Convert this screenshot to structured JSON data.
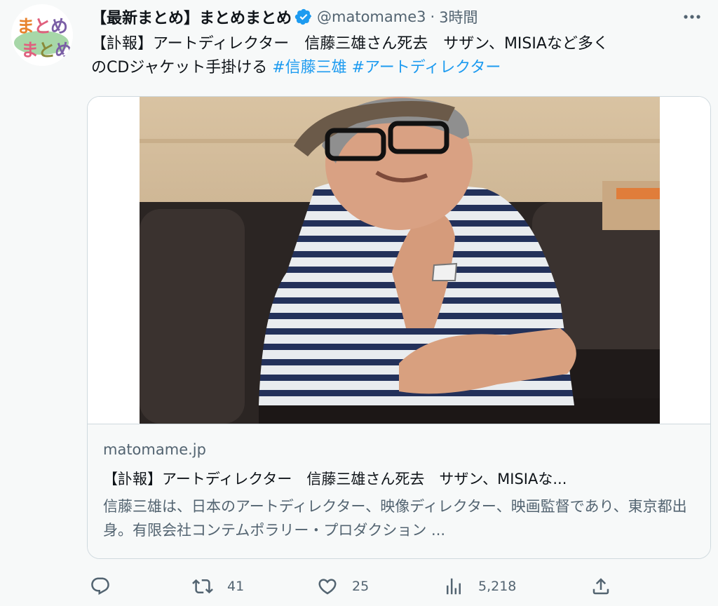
{
  "author": {
    "display_name": "【最新まとめ】まとめまとめ",
    "handle": "@matomame3",
    "separator": "·",
    "time": "3時間",
    "verified": true,
    "avatar_text": [
      "まとめ",
      "まとめ"
    ]
  },
  "tweet": {
    "line1": "【訃報】アートディレクター　信藤三雄さん死去　サザン、MISIAなど多く",
    "line2": "のCDジャケット手掛ける ",
    "hashtags": [
      "#信藤三雄",
      "#アートディレクター"
    ]
  },
  "card": {
    "domain": "matomame.jp",
    "title": "【訃報】アートディレクター　信藤三雄さん死去　サザン、MISIAな...",
    "description": "信藤三雄は、日本のアートディレクター、映像ディレクター、映画監督であり、東京都出身。有限会社コンテムポラリー・プロダクション ..."
  },
  "actions": {
    "reply_count": "",
    "retweet_count": "41",
    "like_count": "25",
    "view_count": "5,218"
  },
  "icons": {
    "verified": "verified-badge-icon",
    "more": "more-dots-icon",
    "reply": "reply-icon",
    "retweet": "retweet-icon",
    "like": "heart-icon",
    "views": "analytics-icon",
    "share": "share-icon"
  },
  "colors": {
    "accent": "#1d9bf0",
    "secondary_text": "#536471",
    "background": "#f7f9f9",
    "border": "#cfd9de"
  }
}
